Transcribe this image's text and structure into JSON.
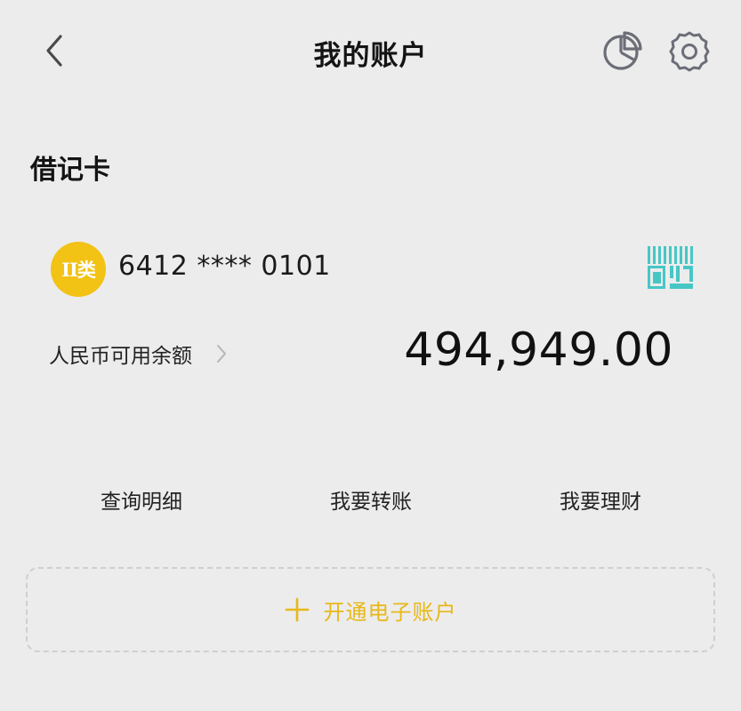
{
  "header": {
    "title": "我的账户"
  },
  "icons": {
    "back": "chevron-left-icon",
    "stats": "pie-chart-icon",
    "settings": "gear-icon",
    "qr": "qr-code-icon",
    "balance_arrow": "chevron-right-icon",
    "open_account": "plus-icon"
  },
  "section": {
    "title": "借记卡"
  },
  "card": {
    "badge": "II类",
    "number": "6412 **** 0101",
    "balance_label": "人民币可用余额",
    "balance": "494,949.00"
  },
  "actions": [
    {
      "label": "查询明细"
    },
    {
      "label": "我要转账"
    },
    {
      "label": "我要理财"
    }
  ],
  "open_account": {
    "label": "开通电子账户"
  },
  "colors": {
    "background": "#ececec",
    "badge": "#f2c215",
    "accent": "#e8b818",
    "qr": "#47c6c6",
    "icon_gray": "#6b6e76"
  }
}
